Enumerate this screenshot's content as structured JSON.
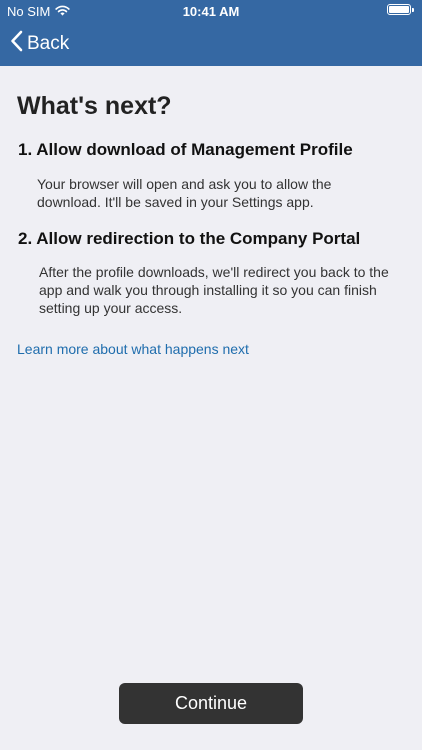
{
  "status_bar": {
    "carrier": "No SIM",
    "time": "10:41 AM",
    "battery_level": 1.0
  },
  "nav": {
    "back_label": "Back"
  },
  "main": {
    "title": "What's next?",
    "steps": [
      {
        "heading": "1. Allow download of Management Profile",
        "body": "Your browser will open and ask you to allow the download. It'll be saved in your Settings app."
      },
      {
        "heading": "2. Allow redirection to the Company Portal",
        "body": "After the profile downloads, we'll redirect you back to the app and walk you through installing it so you can finish setting up your access."
      }
    ],
    "learn_more_link": "Learn more about what happens next"
  },
  "footer": {
    "continue_label": "Continue"
  },
  "colors": {
    "header_bg": "#3568a3",
    "page_bg": "#efeff4",
    "link": "#1f6dad",
    "button_bg": "#333333"
  },
  "icons": {
    "wifi": "wifi-icon",
    "battery": "battery-icon",
    "back": "chevron-left-icon"
  }
}
